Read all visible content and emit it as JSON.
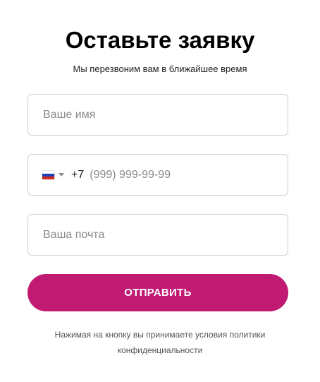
{
  "form": {
    "title": "Оставьте заявку",
    "subtitle": "Мы перезвоним вам в ближайшее время",
    "name_field": {
      "placeholder": "Ваше имя",
      "value": ""
    },
    "phone_field": {
      "country_flag": "russia-flag-icon",
      "dial_code": "+7",
      "placeholder": "(999) 999-99-99",
      "value": ""
    },
    "email_field": {
      "placeholder": "Ваша почта",
      "value": ""
    },
    "submit_label": "ОТПРАВИТЬ",
    "policy_line1": "Нажимая на кнопку вы принимаете условия политики",
    "policy_line2": "конфиденциальности"
  },
  "colors": {
    "accent": "#c01a73",
    "border": "#cfcfcf",
    "flag_white": "#ffffff",
    "flag_blue": "#1c3fb5",
    "flag_red": "#d52b1e"
  }
}
